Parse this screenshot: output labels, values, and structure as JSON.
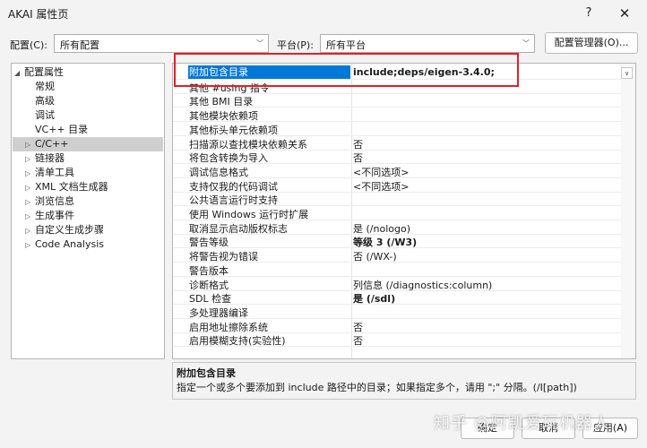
{
  "window": {
    "title": "AKAI 属性页",
    "help": "?",
    "close": "✕"
  },
  "toolbar": {
    "config_label": "配置(C):",
    "config_value": "所有配置",
    "platform_label": "平台(P):",
    "platform_value": "所有平台",
    "config_manager": "配置管理器(O)..."
  },
  "tree": {
    "root": "配置属性",
    "items": [
      "常规",
      "高级",
      "调试",
      "VC++ 目录"
    ],
    "expandable": [
      "C/C++",
      "链接器",
      "清单工具",
      "XML 文档生成器",
      "浏览信息",
      "生成事件",
      "自定义生成步骤",
      "Code Analysis"
    ]
  },
  "props": [
    {
      "name": "附加包含目录",
      "value": "include;deps/eigen-3.4.0;",
      "selected": true
    },
    {
      "name": "其他 #using 指令",
      "value": ""
    },
    {
      "name": "其他 BMI 目录",
      "value": ""
    },
    {
      "name": "其他模块依赖项",
      "value": ""
    },
    {
      "name": "其他标头单元依赖项",
      "value": ""
    },
    {
      "name": "扫描源以查找模块依赖关系",
      "value": "否"
    },
    {
      "name": "将包含转换为导入",
      "value": "否"
    },
    {
      "name": "调试信息格式",
      "value": "<不同选项>"
    },
    {
      "name": "支持仅我的代码调试",
      "value": "<不同选项>"
    },
    {
      "name": "公共语言运行时支持",
      "value": ""
    },
    {
      "name": "使用 Windows 运行时扩展",
      "value": ""
    },
    {
      "name": "取消显示启动版权标志",
      "value": "是 (/nologo)"
    },
    {
      "name": "警告等级",
      "value": "等级 3 (/W3)",
      "bold": true
    },
    {
      "name": "将警告视为错误",
      "value": "否 (/WX-)"
    },
    {
      "name": "警告版本",
      "value": ""
    },
    {
      "name": "诊断格式",
      "value": "列信息 (/diagnostics:column)"
    },
    {
      "name": "SDL 检查",
      "value": "是 (/sdl)",
      "bold": true
    },
    {
      "name": "多处理器编译",
      "value": ""
    },
    {
      "name": "启用地址擦除系统",
      "value": "否"
    },
    {
      "name": "启用模糊支持(实验性)",
      "value": "否"
    }
  ],
  "description": {
    "title": "附加包含目录",
    "text": "指定一个或多个要添加到 include 路径中的目录；如果指定多个，请用 \";\" 分隔。(/I[path])"
  },
  "footer": {
    "ok": "确定",
    "cancel": "取消",
    "apply": "应用(A)"
  },
  "watermark": "知乎 @阿凯爱玩机器人"
}
